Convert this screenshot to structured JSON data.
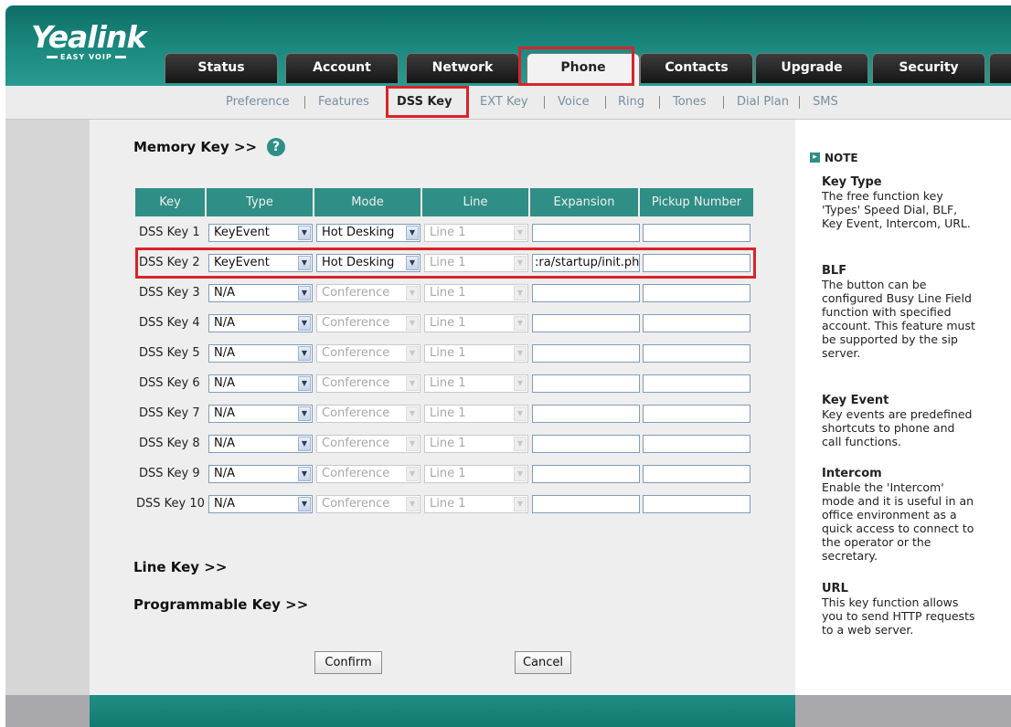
{
  "brand": {
    "logo": "Yealink",
    "tagline": "EASY VOIP"
  },
  "tabs": [
    "Status",
    "Account",
    "Network",
    "Phone",
    "Contacts",
    "Upgrade",
    "Security"
  ],
  "subnav": [
    "Preference",
    "Features",
    "DSS Key",
    "EXT Key",
    "Voice",
    "Ring",
    "Tones",
    "Dial Plan",
    "SMS"
  ],
  "sections": {
    "memory": "Memory Key >>",
    "line": "Line Key >>",
    "programmable": "Programmable Key >>"
  },
  "help_icon": "?",
  "table": {
    "headers": [
      "Key",
      "Type",
      "Mode",
      "Line",
      "Expansion",
      "Pickup Number"
    ],
    "rows": [
      {
        "key": "DSS Key 1",
        "type": "KeyEvent",
        "mode": "Hot Desking",
        "line": "Line 1",
        "expansion": "",
        "pickup": ""
      },
      {
        "key": "DSS Key 2",
        "type": "KeyEvent",
        "mode": "Hot Desking",
        "line": "Line 1",
        "expansion": ":ra/startup/init.php",
        "pickup": ""
      },
      {
        "key": "DSS Key 3",
        "type": "N/A",
        "mode": "Conference",
        "line": "Line 1",
        "expansion": "",
        "pickup": ""
      },
      {
        "key": "DSS Key 4",
        "type": "N/A",
        "mode": "Conference",
        "line": "Line 1",
        "expansion": "",
        "pickup": ""
      },
      {
        "key": "DSS Key 5",
        "type": "N/A",
        "mode": "Conference",
        "line": "Line 1",
        "expansion": "",
        "pickup": ""
      },
      {
        "key": "DSS Key 6",
        "type": "N/A",
        "mode": "Conference",
        "line": "Line 1",
        "expansion": "",
        "pickup": ""
      },
      {
        "key": "DSS Key 7",
        "type": "N/A",
        "mode": "Conference",
        "line": "Line 1",
        "expansion": "",
        "pickup": ""
      },
      {
        "key": "DSS Key 8",
        "type": "N/A",
        "mode": "Conference",
        "line": "Line 1",
        "expansion": "",
        "pickup": ""
      },
      {
        "key": "DSS Key 9",
        "type": "N/A",
        "mode": "Conference",
        "line": "Line 1",
        "expansion": "",
        "pickup": ""
      },
      {
        "key": "DSS Key 10",
        "type": "N/A",
        "mode": "Conference",
        "line": "Line 1",
        "expansion": "",
        "pickup": ""
      }
    ]
  },
  "buttons": {
    "confirm": "Confirm",
    "cancel": "Cancel"
  },
  "note": {
    "heading": "NOTE",
    "items": [
      {
        "title": "Key Type",
        "body": "The free function key 'Types' Speed Dial, BLF, Key Event, Intercom, URL."
      },
      {
        "title": "BLF",
        "body": "The button can be configured Busy Line Field function with specified account. This feature must be supported by the sip server."
      },
      {
        "title": "Key Event",
        "body": "Key events are predefined shortcuts to phone and call functions."
      },
      {
        "title": "Intercom",
        "body": "Enable the 'Intercom' mode and it is useful in an office environment as a quick access to connect to the operator or the secretary."
      },
      {
        "title": "URL",
        "body": "This key function allows you to send HTTP requests to a web server."
      }
    ]
  },
  "colors": {
    "accent": "#2f8f86",
    "highlight": "#d9232a",
    "header_dark": "#0f6e66"
  }
}
